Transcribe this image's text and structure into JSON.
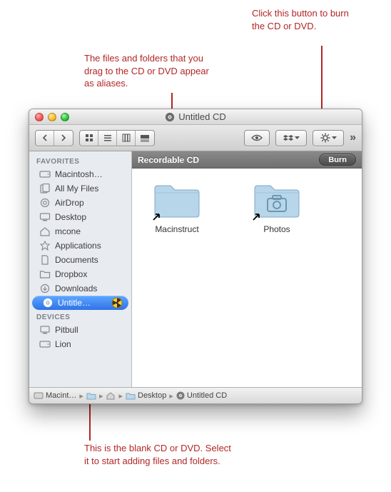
{
  "annotations": {
    "top_right": "Click this button to burn the CD or DVD.",
    "top_left": "The files and folders that you drag to the CD or DVD appear as aliases.",
    "bottom": "This is the blank CD or DVD. Select it to start adding files and folders."
  },
  "window": {
    "title": "Untitled CD"
  },
  "header": {
    "label": "Recordable CD",
    "burn_label": "Burn"
  },
  "sidebar": {
    "section_favorites": "FAVORITES",
    "section_devices": "DEVICES",
    "favorites": [
      {
        "label": "Macintosh…"
      },
      {
        "label": "All My Files"
      },
      {
        "label": "AirDrop"
      },
      {
        "label": "Desktop"
      },
      {
        "label": "mcone"
      },
      {
        "label": "Applications"
      },
      {
        "label": "Documents"
      },
      {
        "label": "Dropbox"
      },
      {
        "label": "Downloads"
      },
      {
        "label": "Untitle…"
      }
    ],
    "devices": [
      {
        "label": "Pitbull"
      },
      {
        "label": "Lion"
      }
    ]
  },
  "content": {
    "items": [
      {
        "name": "Macinstruct"
      },
      {
        "name": "Photos"
      }
    ]
  },
  "path": {
    "segments": [
      {
        "label": "Macint…"
      },
      {
        "label": ""
      },
      {
        "label": "Desktop"
      },
      {
        "label": "Untitled CD"
      }
    ]
  }
}
